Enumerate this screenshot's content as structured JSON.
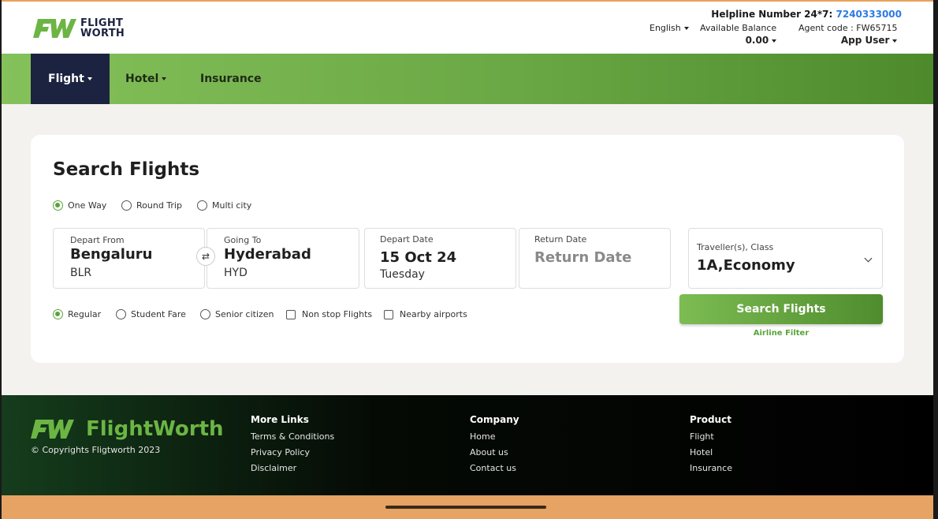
{
  "header": {
    "logo_text_1": "FLIGHT",
    "logo_text_2": "WORTH",
    "helpline_label": "Helpline Number 24*7:",
    "helpline_number": "7240333000",
    "language": "English",
    "balance_label": "Available Balance",
    "balance_value": "0.00",
    "agent_code": "Agent code : FW65715",
    "user_name": "App User"
  },
  "nav": {
    "items": [
      {
        "label": "Flight",
        "active": true,
        "dropdown": true
      },
      {
        "label": "Hotel",
        "active": false,
        "dropdown": true
      },
      {
        "label": "Insurance",
        "active": false,
        "dropdown": false
      }
    ]
  },
  "search": {
    "title": "Search Flights",
    "trip_types": [
      "One Way",
      "Round Trip",
      "Multi city"
    ],
    "selected_trip": "One Way",
    "from": {
      "label": "Depart From",
      "city": "Bengaluru",
      "code": "BLR"
    },
    "to": {
      "label": "Going To",
      "city": "Hyderabad",
      "code": "HYD"
    },
    "depart": {
      "label": "Depart Date",
      "date": "15 Oct 24",
      "day": "Tuesday"
    },
    "return": {
      "label": "Return Date",
      "placeholder": "Return Date"
    },
    "traveller": {
      "label": "Traveller(s), Class",
      "value": "1A,Economy"
    },
    "fare_types": [
      "Regular",
      "Student Fare",
      "Senior citizen"
    ],
    "selected_fare": "Regular",
    "options": [
      "Non stop Flights",
      "Nearby airports"
    ],
    "search_button": "Search Flights",
    "airline_filter": "Airline Filter"
  },
  "footer": {
    "brand": "FlightWorth",
    "copyright": "© Copyrights Fligtworth 2023",
    "columns": [
      {
        "heading": "More Links",
        "links": [
          "Terms & Conditions",
          "Privacy Policy",
          "Disclaimer"
        ]
      },
      {
        "heading": "Company",
        "links": [
          "Home",
          "About us",
          "Contact us"
        ]
      },
      {
        "heading": "Product",
        "links": [
          "Flight",
          "Hotel",
          "Insurance"
        ]
      }
    ]
  },
  "colors": {
    "brand_green": "#6cb544",
    "nav_dark": "#1c2340",
    "link_blue": "#2b7be4",
    "accent_orange": "#e6a363"
  }
}
